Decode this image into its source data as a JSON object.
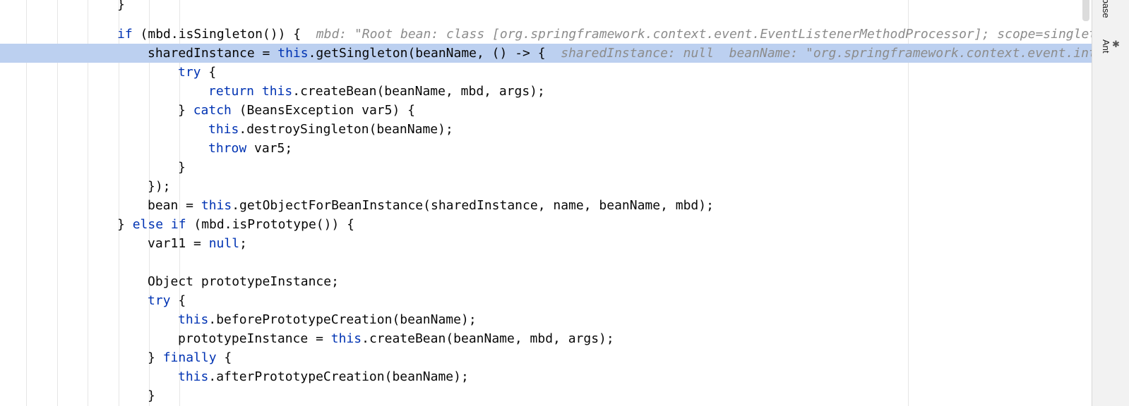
{
  "editor": {
    "lines": [
      {
        "indent": 4,
        "segments": [
          {
            "t": "}",
            "c": "p"
          }
        ]
      },
      {
        "indent": 0,
        "segments": []
      },
      {
        "indent": 4,
        "segments": [
          {
            "t": "if",
            "c": "kw"
          },
          {
            "t": " (mbd.isSingleton()) {  ",
            "c": "p"
          },
          {
            "t": "mbd: \"Root bean: class [org.springframework.context.event.EventListenerMethodProcessor]; scope=singlet",
            "c": "hint"
          }
        ]
      },
      {
        "indent": 5,
        "exec": true,
        "segments": [
          {
            "t": "sharedInstance = ",
            "c": "p"
          },
          {
            "t": "this",
            "c": "kw"
          },
          {
            "t": ".getSingleton(beanName, () -> {  ",
            "c": "p"
          },
          {
            "t": "sharedInstance: null  beanName: \"org.springframework.context.event.int",
            "c": "hint"
          }
        ]
      },
      {
        "indent": 6,
        "segments": [
          {
            "t": "try",
            "c": "kw"
          },
          {
            "t": " {",
            "c": "p"
          }
        ]
      },
      {
        "indent": 7,
        "segments": [
          {
            "t": "return",
            "c": "kw"
          },
          {
            "t": " ",
            "c": "p"
          },
          {
            "t": "this",
            "c": "kw"
          },
          {
            "t": ".createBean(beanName, mbd, args);",
            "c": "p"
          }
        ]
      },
      {
        "indent": 6,
        "segments": [
          {
            "t": "} ",
            "c": "p"
          },
          {
            "t": "catch",
            "c": "kw"
          },
          {
            "t": " (BeansException var5) {",
            "c": "p"
          }
        ]
      },
      {
        "indent": 7,
        "segments": [
          {
            "t": "this",
            "c": "kw"
          },
          {
            "t": ".destroySingleton(beanName);",
            "c": "p"
          }
        ]
      },
      {
        "indent": 7,
        "segments": [
          {
            "t": "throw",
            "c": "kw"
          },
          {
            "t": " var5;",
            "c": "p"
          }
        ]
      },
      {
        "indent": 6,
        "segments": [
          {
            "t": "}",
            "c": "p"
          }
        ]
      },
      {
        "indent": 5,
        "segments": [
          {
            "t": "});",
            "c": "p"
          }
        ]
      },
      {
        "indent": 5,
        "segments": [
          {
            "t": "bean = ",
            "c": "p"
          },
          {
            "t": "this",
            "c": "kw"
          },
          {
            "t": ".getObjectForBeanInstance(sharedInstance, name, beanName, mbd);",
            "c": "p"
          }
        ]
      },
      {
        "indent": 4,
        "segments": [
          {
            "t": "} ",
            "c": "p"
          },
          {
            "t": "else if",
            "c": "kw"
          },
          {
            "t": " (mbd.isPrototype()) {",
            "c": "p"
          }
        ]
      },
      {
        "indent": 5,
        "segments": [
          {
            "t": "var11 = ",
            "c": "p"
          },
          {
            "t": "null",
            "c": "kw"
          },
          {
            "t": ";",
            "c": "p"
          }
        ]
      },
      {
        "indent": 0,
        "segments": []
      },
      {
        "indent": 5,
        "segments": [
          {
            "t": "Object prototypeInstance;",
            "c": "p"
          }
        ]
      },
      {
        "indent": 5,
        "segments": [
          {
            "t": "try",
            "c": "kw"
          },
          {
            "t": " {",
            "c": "p"
          }
        ]
      },
      {
        "indent": 6,
        "segments": [
          {
            "t": "this",
            "c": "kw"
          },
          {
            "t": ".beforePrototypeCreation(beanName);",
            "c": "p"
          }
        ]
      },
      {
        "indent": 6,
        "segments": [
          {
            "t": "prototypeInstance = ",
            "c": "p"
          },
          {
            "t": "this",
            "c": "kw"
          },
          {
            "t": ".createBean(beanName, mbd, args);",
            "c": "p"
          }
        ]
      },
      {
        "indent": 5,
        "segments": [
          {
            "t": "} ",
            "c": "p"
          },
          {
            "t": "finally",
            "c": "kw"
          },
          {
            "t": " {",
            "c": "p"
          }
        ]
      },
      {
        "indent": 6,
        "segments": [
          {
            "t": "this",
            "c": "kw"
          },
          {
            "t": ".afterPrototypeCreation(beanName);",
            "c": "p"
          }
        ]
      },
      {
        "indent": 5,
        "segments": [
          {
            "t": "}",
            "c": "p"
          }
        ]
      }
    ]
  },
  "tool_windows": {
    "database_label": "Database",
    "ant_label": "Ant",
    "ant_icon": "ant-icon"
  }
}
